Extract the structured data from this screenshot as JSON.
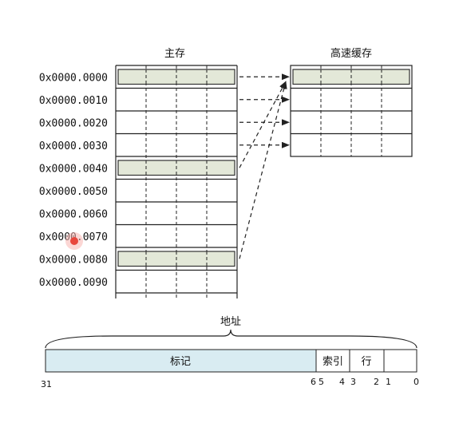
{
  "main_memory": {
    "title": "主存",
    "addresses": [
      "0x0000.0000",
      "0x0000.0010",
      "0x0000.0020",
      "0x0000.0030",
      "0x0000.0040",
      "0x0000.0050",
      "0x0000.0060",
      "0x0000.0070",
      "0x0000.0080",
      "0x0000.0090"
    ],
    "highlighted_rows": [
      0,
      4,
      8
    ]
  },
  "cache": {
    "title": "高速缓存",
    "row_count": 4,
    "highlighted_rows": [
      0
    ]
  },
  "mappings": [
    {
      "from_row": 0,
      "to_row": 0
    },
    {
      "from_row": 1,
      "to_row": 1
    },
    {
      "from_row": 2,
      "to_row": 2
    },
    {
      "from_row": 3,
      "to_row": 3
    },
    {
      "from_row": 4,
      "to_row": 0
    },
    {
      "from_row": 8,
      "to_row": 0
    }
  ],
  "address_format": {
    "title": "地址",
    "fields": {
      "tag": "标记",
      "index": "索引",
      "line": "行",
      "offset": ""
    },
    "bit_labels": {
      "b31": "31",
      "b6": "6",
      "b5": "5",
      "b4": "4",
      "b3": "3",
      "b2": "2",
      "b1": "1",
      "b0": "0"
    }
  },
  "colors": {
    "highlight_fill": "#e3e8d8",
    "tag_fill": "#d9ecf2",
    "cursor": "#e8463c"
  }
}
